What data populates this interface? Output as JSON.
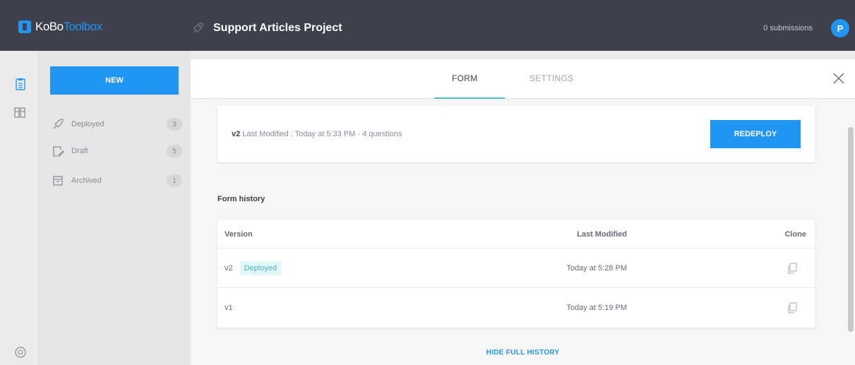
{
  "header": {
    "logo_kobo": "KoBo",
    "logo_toolbox": "Toolbox",
    "project_title": "Support Articles Project",
    "submissions": "0 submissions",
    "avatar_initial": "P",
    "accent_color": "#2095f3",
    "icons": [
      "rocket-icon"
    ]
  },
  "rail": {
    "icons": [
      "forms-icon",
      "library-icon",
      "help-icon"
    ]
  },
  "sidebar": {
    "new_label": "NEW",
    "items": [
      {
        "label": "Deployed",
        "count": "3",
        "icon": "rocket-icon"
      },
      {
        "label": "Draft",
        "count": "5",
        "icon": "draft-icon"
      },
      {
        "label": "Archived",
        "count": "1",
        "icon": "archive-icon"
      }
    ]
  },
  "main": {
    "tabs": [
      {
        "label": "FORM",
        "active": true
      },
      {
        "label": "SETTINGS",
        "active": false
      }
    ],
    "current_version": {
      "version": "v2",
      "details": "Last Modified : Today at 5:33 PM - 4 questions"
    },
    "redeploy_label": "REDEPLOY",
    "history_title": "Form history",
    "history": {
      "columns": [
        "Version",
        "Last Modified",
        "Clone"
      ],
      "rows": [
        {
          "version": "v2",
          "badge": "Deployed",
          "modified": "Today at 5:28 PM"
        },
        {
          "version": "v1",
          "badge": "",
          "modified": "Today at 5:19 PM"
        }
      ]
    },
    "hide_history_label": "HIDE FULL HISTORY"
  }
}
